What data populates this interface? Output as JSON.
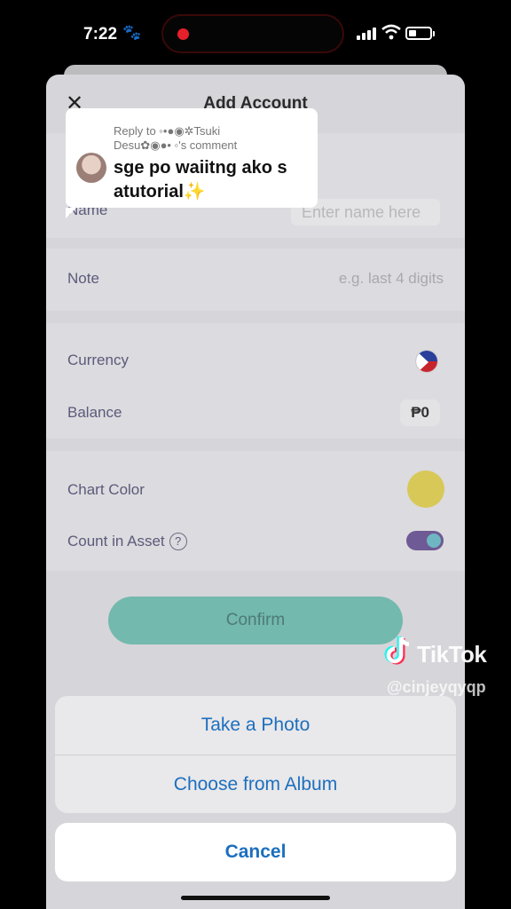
{
  "status_bar": {
    "time": "7:22"
  },
  "sheet": {
    "title": "Add Account",
    "name_label": "Name",
    "name_placeholder": "Enter name here",
    "note_label": "Note",
    "note_placeholder": "e.g. last 4 digits",
    "currency_label": "Currency",
    "balance_label": "Balance",
    "balance_value": "₱0",
    "chart_color_label": "Chart Color",
    "chart_color": "#d8c858",
    "count_in_asset_label": "Count in Asset",
    "count_in_asset_on": true,
    "confirm_label": "Confirm"
  },
  "action_sheet": {
    "take_photo": "Take a Photo",
    "choose_album": "Choose from Album",
    "cancel": "Cancel"
  },
  "reply_overlay": {
    "line1": "Reply to ◦•●◉✲Tsuki",
    "line2": "Desu✿◉●• ◦'s comment",
    "message": "sge po waiitng ako s atutorial✨"
  },
  "watermark": {
    "brand": "TikTok",
    "username": "@cinjeyqyqp"
  },
  "colors": {
    "accent": "#1c6fbf",
    "confirm": "#73b9ad",
    "toggle": "#6e5a95"
  }
}
